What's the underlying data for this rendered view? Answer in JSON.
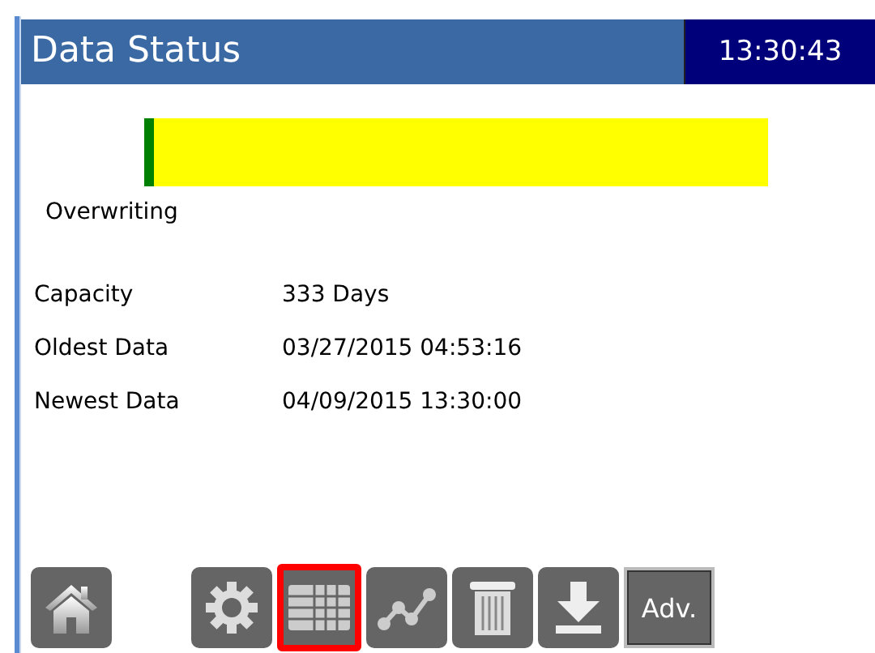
{
  "header": {
    "title": "Data Status",
    "clock": "13:30:43"
  },
  "storage": {
    "level": 0.015,
    "status": "Overwriting"
  },
  "details": [
    {
      "label": "Capacity",
      "value": "333 Days"
    },
    {
      "label": "Oldest Data",
      "value": "03/27/2015 04:53:16"
    },
    {
      "label": "Newest Data",
      "value": "04/09/2015 13:30:00"
    }
  ],
  "toolbar": [
    {
      "kind": "home",
      "selected": false
    },
    {
      "kind": "gear",
      "selected": false
    },
    {
      "kind": "table",
      "selected": true
    },
    {
      "kind": "chart",
      "selected": false
    },
    {
      "kind": "trash",
      "selected": false
    },
    {
      "kind": "download",
      "selected": false
    },
    {
      "kind": "text",
      "label": "Adv.",
      "selected": false
    }
  ]
}
